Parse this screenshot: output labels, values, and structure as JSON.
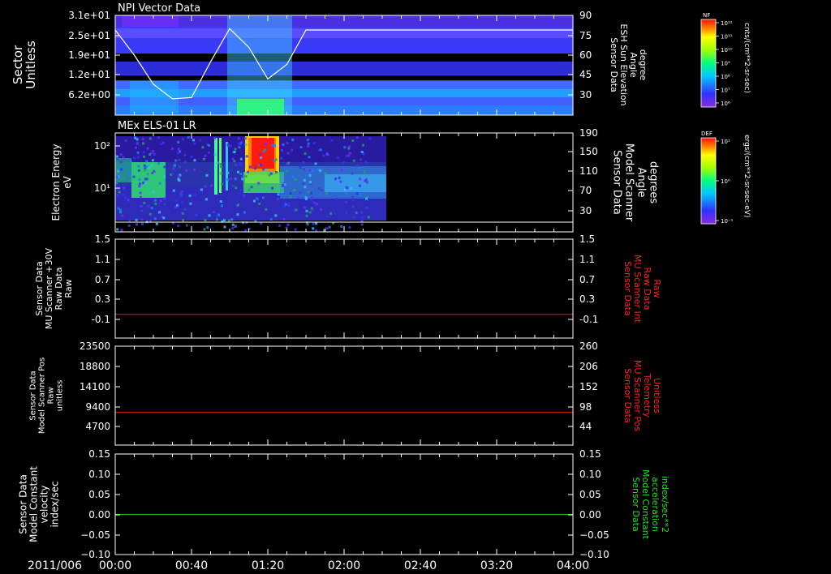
{
  "date_label": "2011/006",
  "time_ticks": [
    "00:00",
    "00:40",
    "01:20",
    "02:00",
    "02:40",
    "03:20",
    "04:00"
  ],
  "colors": {
    "red_trace": "#e02020",
    "green_trace": "#22cc22",
    "red_label": "#ff2020",
    "green_label": "#22dd22",
    "axis": "#ffffff"
  },
  "colorbar_1": {
    "title": "NF",
    "unit": "cnts/(cm**2-sr-sec)",
    "ticks": [
      "10¹²",
      "10¹¹",
      "10¹⁰",
      "10⁹",
      "10⁸",
      "10⁷",
      "10⁶"
    ]
  },
  "colorbar_2": {
    "title": "DEF",
    "unit": "ergs/(cm**2-sr-sec-eV)",
    "ticks": [
      "10¹",
      "10⁰",
      "10⁻¹"
    ]
  },
  "chart_data": [
    {
      "type": "heatmap",
      "title": "NPI Vector Data",
      "ylabel_lines": [
        "Sector",
        "Unitless"
      ],
      "yticks": [
        "3.1e+01",
        "2.5e+01",
        "1.9e+01",
        "1.2e+01",
        "6.2e+00"
      ],
      "right_ylabel_lines": [
        "Sensor Data",
        "ESH Sun Elevation",
        "Angle",
        "degree"
      ],
      "right_yticks": [
        "90",
        "75",
        "60",
        "45",
        "30"
      ],
      "overlay_series": {
        "name": "ESH Sun Elevation Angle",
        "x_minutes": [
          0,
          10,
          20,
          30,
          40,
          50,
          60,
          70,
          80,
          90,
          100,
          110,
          120,
          240
        ],
        "y_deg": [
          79,
          60,
          38,
          27,
          28,
          55,
          80,
          66,
          42,
          53,
          79,
          79,
          79,
          79
        ]
      }
    },
    {
      "type": "heatmap",
      "title": "MEx ELS-01 LR",
      "ylabel_lines": [
        "Electron Energy",
        "eV"
      ],
      "yticks": [
        "10²",
        "10¹"
      ],
      "right_ylabel_lines": [
        "Sensor Data",
        "Model Scanner",
        "Angle",
        "degrees"
      ],
      "right_yticks": [
        "190",
        "150",
        "110",
        "70",
        "30"
      ],
      "data_end_minutes": 133
    },
    {
      "type": "line",
      "ylabel_lines": [
        "Sensor Data",
        "MU Scanner +30V",
        "Raw Data",
        "Raw"
      ],
      "yticks": [
        "1.5",
        "1.1",
        "0.7",
        "0.3",
        "-0.1"
      ],
      "right_ylabel_lines": [
        "Sensor Data",
        "MU Scanner Int",
        "Raw Data",
        "Raw"
      ],
      "right_yticks": [
        "1.5",
        "1.1",
        "0.7",
        "0.3",
        "-0.1"
      ],
      "ylim": [
        -0.3,
        1.5
      ],
      "series": [
        {
          "values": [
            0,
            0
          ]
        }
      ],
      "x_minutes": [
        0,
        240
      ]
    },
    {
      "type": "line",
      "ylabel_lines": [
        "Sensor Data",
        "Model Scanner Pos",
        "Raw",
        "unitless"
      ],
      "yticks": [
        "23500",
        "18800",
        "14100",
        "9400",
        "4700"
      ],
      "right_ylabel_lines": [
        "Sensor Data",
        "MU Scanner Pos",
        "Telemetry",
        "Unitless"
      ],
      "right_yticks": [
        "260",
        "206",
        "152",
        "98",
        "44"
      ],
      "ylim": [
        0,
        23500
      ],
      "series": [
        {
          "values": [
            8000,
            8000
          ]
        }
      ],
      "x_minutes": [
        0,
        240
      ]
    },
    {
      "type": "line",
      "ylabel_lines": [
        "Sensor Data",
        "Model Constant",
        "velocity",
        "index/sec"
      ],
      "yticks": [
        "0.15",
        "0.10",
        "0.05",
        "0.00",
        "−0.05",
        "−0.10"
      ],
      "right_ylabel_lines": [
        "Sensor Data",
        "Model Constant",
        "acceleration",
        "index/sec**2"
      ],
      "right_yticks": [
        "0.15",
        "0.10",
        "0.05",
        "0.00",
        "−0.05",
        "−0.10"
      ],
      "ylim": [
        -0.1,
        0.15
      ],
      "series": [
        {
          "values": [
            0,
            0
          ]
        }
      ],
      "x_minutes": [
        0,
        240
      ]
    }
  ]
}
